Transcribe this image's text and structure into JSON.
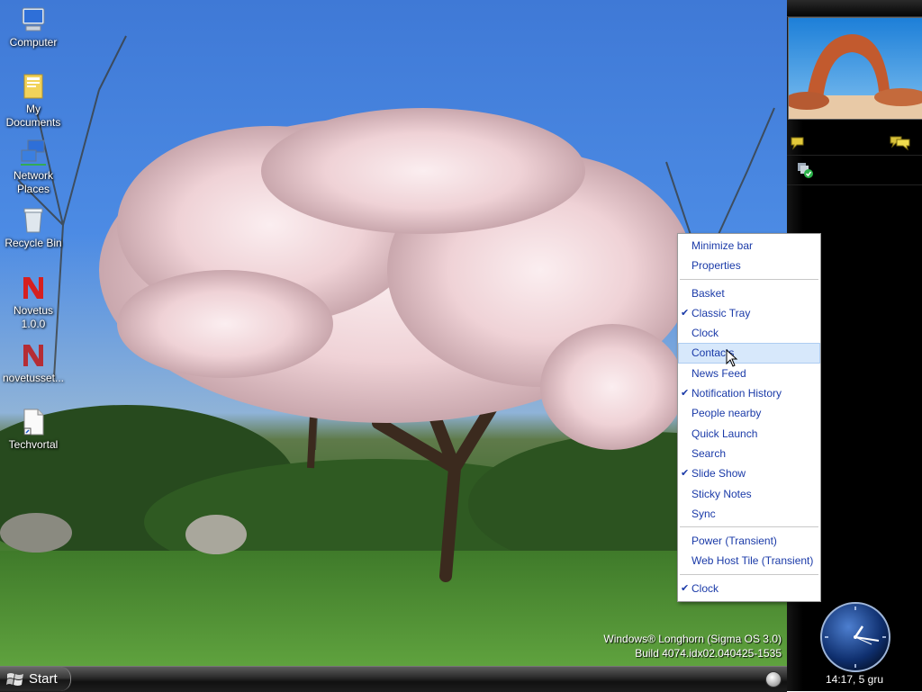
{
  "desktop_icons": [
    {
      "label": "Computer",
      "icon": "computer-icon"
    },
    {
      "label": "My Documents",
      "icon": "folder-documents-icon"
    },
    {
      "label": "Network Places",
      "icon": "network-places-icon"
    },
    {
      "label": "Recycle Bin",
      "icon": "recycle-bin-icon"
    },
    {
      "label": "Novetus 1.0.0",
      "icon": "novetus-icon"
    },
    {
      "label": "novetusset...",
      "icon": "novetus-setup-icon"
    },
    {
      "label": "Techvortal",
      "icon": "document-shortcut-icon"
    }
  ],
  "watermark": {
    "line1": "Windows® Longhorn (Sigma OS 3.0)",
    "line2": "Build 4074.idx02.040425-1535"
  },
  "taskbar": {
    "start_label": "Start"
  },
  "sidebar": {
    "clock_text": "14:17, 5 gru"
  },
  "context_menu": {
    "groups": [
      [
        {
          "label": "Minimize bar",
          "checked": false
        },
        {
          "label": "Properties",
          "checked": false
        }
      ],
      [
        {
          "label": "Basket",
          "checked": false
        },
        {
          "label": "Classic Tray",
          "checked": true
        },
        {
          "label": "Clock",
          "checked": false
        },
        {
          "label": "Contacts",
          "checked": false,
          "highlighted": true
        },
        {
          "label": "News Feed",
          "checked": false
        },
        {
          "label": "Notification History",
          "checked": true
        },
        {
          "label": "People nearby",
          "checked": false
        },
        {
          "label": "Quick Launch",
          "checked": false
        },
        {
          "label": "Search",
          "checked": false
        },
        {
          "label": "Slide Show",
          "checked": true
        },
        {
          "label": "Sticky Notes",
          "checked": false
        },
        {
          "label": "Sync",
          "checked": false
        }
      ],
      [
        {
          "label": "Power (Transient)",
          "checked": false
        },
        {
          "label": "Web Host Tile (Transient)",
          "checked": false
        }
      ],
      [
        {
          "label": "Clock",
          "checked": true
        }
      ]
    ],
    "check_glyph": "✔",
    "text_color": "#1a3aa8",
    "highlight_color": "#d7e8fb"
  }
}
